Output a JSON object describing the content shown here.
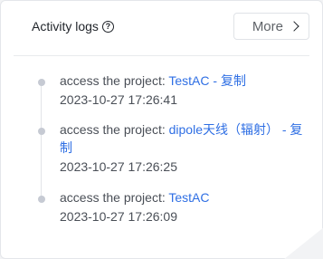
{
  "header": {
    "title": "Activity logs",
    "help_icon": "?",
    "more_label": "More"
  },
  "logs": [
    {
      "prefix": "access the project:",
      "link": "TestAC - 复制",
      "time": "2023-10-27 17:26:41"
    },
    {
      "prefix": "access the project:",
      "link": "dipole天线（辐射） - 复制",
      "time": "2023-10-27 17:26:25"
    },
    {
      "prefix": "access the project:",
      "link": "TestAC",
      "time": "2023-10-27 17:26:09"
    }
  ],
  "colors": {
    "link": "#2f6fe4",
    "dot": "#c6cad3",
    "text": "#4a4f57"
  }
}
